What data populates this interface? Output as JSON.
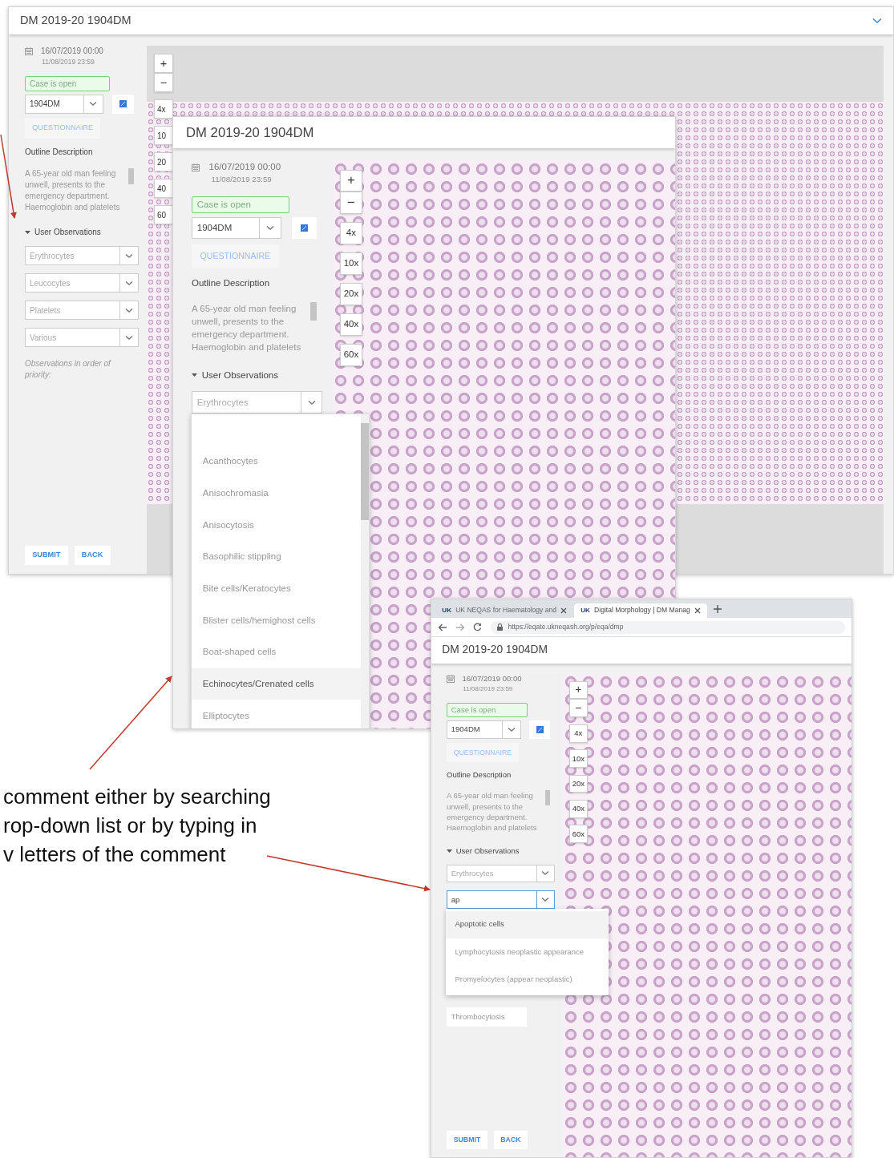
{
  "windows": [
    {
      "kind": "plain",
      "collapsible": true,
      "title": "DM 2019-20 1904DM",
      "date_from": "16/07/2019 00:00",
      "date_to": "11/08/2019 23:59",
      "status": "Case is open",
      "case": "1904DM",
      "questionnaire": "QUESTIONNAIRE",
      "outline_heading": "Outline Description",
      "outline_text": "A 65-year old man feeling unwell, presents to the emergency department. Haemoglobin and platelets",
      "observations_heading": "User Observations",
      "fields": [
        {
          "placeholder": "Erythrocytes"
        },
        {
          "placeholder": "Leucocytes"
        },
        {
          "placeholder": "Platelets"
        },
        {
          "placeholder": "Various"
        }
      ],
      "hint": "Observations in order of priority:",
      "buttons": [
        "SUBMIT",
        "BACK"
      ],
      "zoom_controls": [
        "+",
        "−"
      ],
      "magnifications": [
        "4x",
        "10",
        "20",
        "40",
        "60"
      ]
    },
    {
      "kind": "plain",
      "collapsible": false,
      "title": "DM 2019-20 1904DM",
      "date_from": "16/07/2019 00:00",
      "date_to": "11/08/2019 23:59",
      "status": "Case is open",
      "case": "1904DM",
      "questionnaire": "QUESTIONNAIRE",
      "outline_heading": "Outline Description",
      "outline_text": "A 65-year old man feeling unwell, presents to the emergency department. Haemoglobin and platelets",
      "observations_heading": "User Observations",
      "fields": [
        {
          "placeholder": "Erythrocytes"
        }
      ],
      "dropdown": [
        {
          "label": "Acanthocytes",
          "selected": false
        },
        {
          "label": "Anisochromasia",
          "selected": false
        },
        {
          "label": "Anisocytosis",
          "selected": false
        },
        {
          "label": "Basophilic stippling",
          "selected": false
        },
        {
          "label": "Bite cells/Keratocytes",
          "selected": false
        },
        {
          "label": "Blister cells/hemighost cells",
          "selected": false
        },
        {
          "label": "Boat-shaped cells",
          "selected": false
        },
        {
          "label": "Echinocytes/Crenated cells",
          "selected": true
        },
        {
          "label": "Elliptocytes",
          "selected": false
        }
      ],
      "zoom_controls": [
        "+",
        "−"
      ],
      "magnifications": [
        "4x",
        "10x",
        "20x",
        "40x",
        "60x"
      ]
    },
    {
      "kind": "browser",
      "collapsible": false,
      "tabs": [
        {
          "favicon": "UK",
          "label": "UK NEQAS for Haematology and",
          "selected": false
        },
        {
          "favicon": "UK",
          "label": "Digital Morphology | DM Manag",
          "selected": true
        }
      ],
      "url": "https://eqate.ukneqash.org/p/eqa/dmp",
      "title": "DM 2019-20 1904DM",
      "date_from": "16/07/2019 00:00",
      "date_to": "11/08/2019 23:59",
      "status": "Case is open",
      "case": "1904DM",
      "questionnaire": "QUESTIONNAIRE",
      "outline_heading": "Outline Description",
      "outline_text": "A 65-year old man feeling unwell, presents to the emergency department. Haemoglobin and platelets",
      "observations_heading": "User Observations",
      "fields": [
        {
          "placeholder": "Erythrocytes"
        },
        {
          "value": "ap",
          "focused": true
        }
      ],
      "dropdown": [
        {
          "label": "Apoptotic cells",
          "selected": true
        },
        {
          "label": "Lymphocytosis neoplastic appearance",
          "selected": false
        },
        {
          "label": "Promyelocytes (appear neoplastic)",
          "selected": false
        }
      ],
      "tags": [
        "Thrombocytosis"
      ],
      "buttons": [
        "SUBMIT",
        "BACK"
      ],
      "zoom_controls": [
        "+",
        "−"
      ],
      "magnifications": [
        "4x",
        "10x",
        "20x",
        "40x",
        "60x"
      ]
    }
  ],
  "annotation_lines": [
    "comment either by searching",
    "rop-down list or by typing in",
    "v letters of the comment"
  ]
}
